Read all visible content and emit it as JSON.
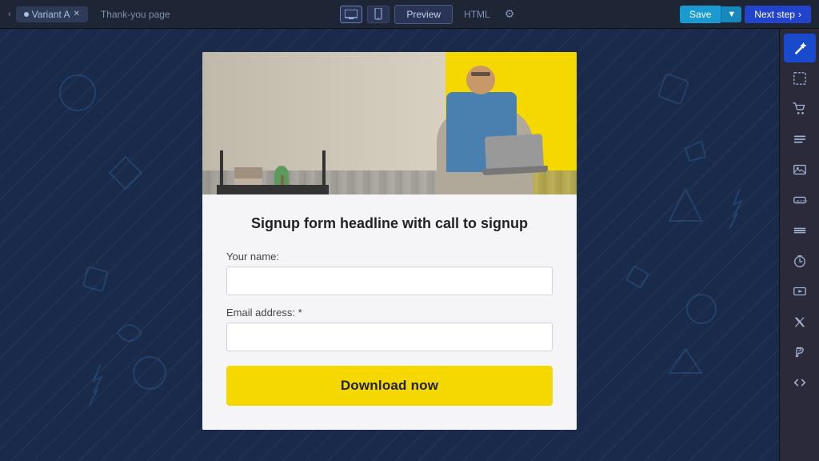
{
  "topbar": {
    "variant_label": "Variant A",
    "thankyou_label": "Thank-you page",
    "preview_label": "Preview",
    "html_label": "HTML",
    "save_label": "Save",
    "nextstep_label": "Next step"
  },
  "form": {
    "headline": "Signup form headline with call to signup",
    "name_label": "Your name:",
    "email_label": "Email address: *",
    "button_label": "Download now",
    "name_placeholder": "",
    "email_placeholder": ""
  },
  "sidebar": {
    "icons": [
      {
        "name": "magic-wand-icon",
        "symbol": "✦",
        "active": true
      },
      {
        "name": "select-icon",
        "symbol": "⬚",
        "active": false
      },
      {
        "name": "cart-icon",
        "symbol": "🛒",
        "active": false
      },
      {
        "name": "menu-icon",
        "symbol": "☰",
        "active": false
      },
      {
        "name": "image-icon",
        "symbol": "🖼",
        "active": false
      },
      {
        "name": "button-icon",
        "symbol": "▭",
        "active": false
      },
      {
        "name": "divider-icon",
        "symbol": "─",
        "active": false
      },
      {
        "name": "timer-icon",
        "symbol": "⏱",
        "active": false
      },
      {
        "name": "video-icon",
        "symbol": "▶",
        "active": false
      },
      {
        "name": "twitter-icon",
        "symbol": "𝕏",
        "active": false
      },
      {
        "name": "paypal-icon",
        "symbol": "P",
        "active": false
      },
      {
        "name": "code-icon",
        "symbol": "</>",
        "active": false
      }
    ]
  }
}
